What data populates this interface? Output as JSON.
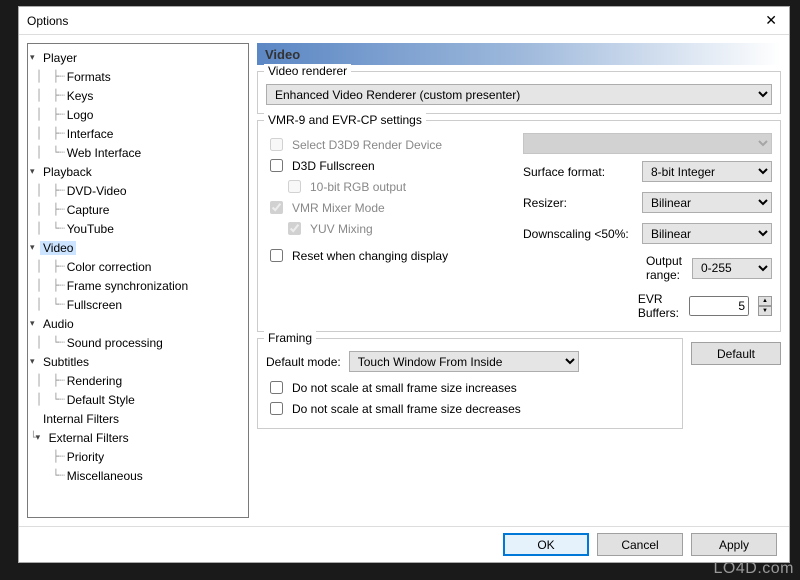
{
  "window": {
    "title": "Options"
  },
  "tree": {
    "groups": [
      {
        "label": "Player",
        "children": [
          "Formats",
          "Keys",
          "Logo",
          "Interface",
          "Web Interface"
        ]
      },
      {
        "label": "Playback",
        "children": [
          "DVD-Video",
          "Capture",
          "YouTube"
        ]
      },
      {
        "label": "Video",
        "children": [
          "Color correction",
          "Frame synchronization",
          "Fullscreen"
        ],
        "selected": true
      },
      {
        "label": "Audio",
        "children": [
          "Sound processing"
        ]
      },
      {
        "label": "Subtitles",
        "children": [
          "Rendering",
          "Default Style"
        ]
      },
      {
        "label": "Internal Filters",
        "children": []
      },
      {
        "label": "External Filters",
        "children": [
          "Priority",
          "Miscellaneous"
        ]
      }
    ]
  },
  "page": {
    "heading": "Video",
    "renderer_group": "Video renderer",
    "renderer_value": "Enhanced Video Renderer (custom presenter)",
    "vmr_group": "VMR-9 and EVR-CP settings",
    "vmr": {
      "select_d3d9_label": "Select D3D9 Render Device",
      "d3d_fullscreen": "D3D Fullscreen",
      "rgb10": "10-bit RGB output",
      "vmr_mixer": "VMR Mixer Mode",
      "yuv": "YUV Mixing",
      "reset_display": "Reset when changing display",
      "surface_format_label": "Surface format:",
      "surface_format_value": "8-bit Integer",
      "resizer_label": "Resizer:",
      "resizer_value": "Bilinear",
      "downscaling_label": "Downscaling <50%:",
      "downscaling_value": "Bilinear",
      "output_range_label": "Output range:",
      "output_range_value": "0-255",
      "evr_buffers_label": "EVR Buffers:",
      "evr_buffers_value": "5"
    },
    "framing_group": "Framing",
    "framing": {
      "default_mode_label": "Default mode:",
      "default_mode_value": "Touch Window From Inside",
      "no_scale_inc": "Do not scale at small frame size increases",
      "no_scale_dec": "Do not scale at small frame size decreases"
    },
    "default_button": "Default"
  },
  "footer": {
    "ok": "OK",
    "cancel": "Cancel",
    "apply": "Apply"
  },
  "watermark": "LO4D.com"
}
